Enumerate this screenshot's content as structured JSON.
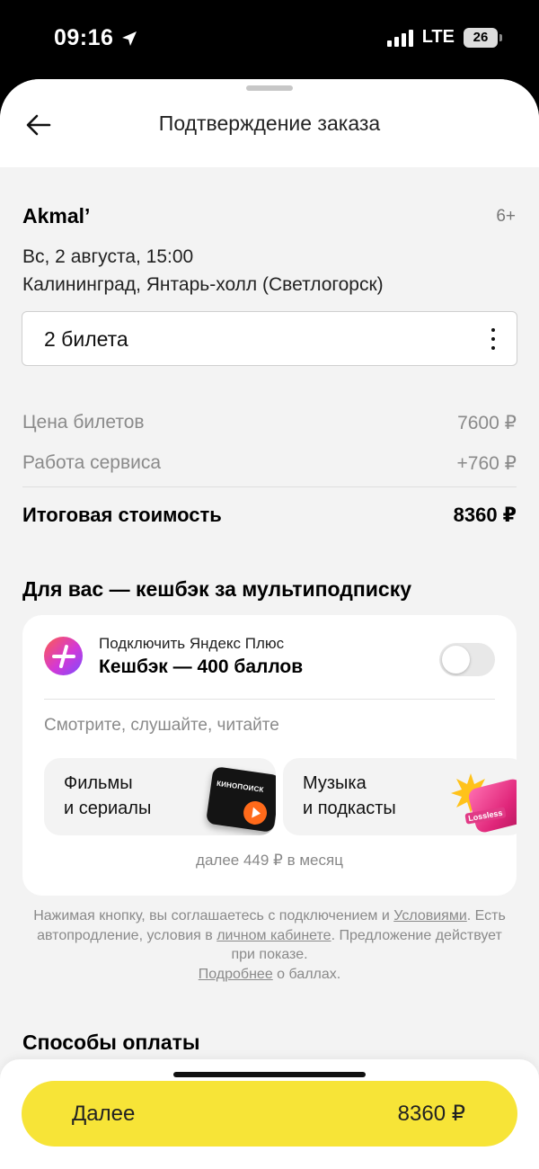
{
  "status_bar": {
    "time": "09:16",
    "network": "LTE",
    "battery": "26"
  },
  "header": {
    "title": "Подтверждение заказа"
  },
  "event": {
    "title": "Akmal’",
    "age": "6+",
    "date": "Вс, 2 августа, 15:00",
    "place": "Калининград, Янтарь-холл (Светлогорск)"
  },
  "tickets": {
    "selected": "2 билета"
  },
  "prices": {
    "tickets_label": "Цена билетов",
    "tickets_value": "7600 ₽",
    "service_label": "Работа сервиса",
    "service_value": "+760 ₽",
    "total_label": "Итоговая стоимость",
    "total_value": "8360 ₽"
  },
  "plus": {
    "section_title": "Для вас — кешбэк за мультиподписку",
    "subtitle": "Подключить Яндекс Плюс",
    "cashback": "Кешбэк — 400 баллов",
    "toggle_on": false,
    "caption": "Смотрите, слушайте, читайте",
    "tiles": [
      {
        "line1": "Фильмы",
        "line2": "и сериалы",
        "icon": "kinopoisk-icon",
        "badge": "КИНОПОИСК"
      },
      {
        "line1": "Музыка",
        "line2": "и подкасты",
        "icon": "music-icon",
        "badge": "Lossless"
      }
    ],
    "note": "далее 449 ₽ в месяц"
  },
  "legal": {
    "part1": "Нажимая кнопку, вы соглашаетесь с подключением и ",
    "link_terms": "Условиями",
    "part2": ". Есть автопродление, условия в ",
    "link_cabinet": "личном кабинете",
    "part3": ". Предложение действует при показе.",
    "link_more": "Подробнее",
    "part4": " о баллах."
  },
  "payment": {
    "section_title": "Способы оплаты"
  },
  "cta": {
    "label": "Далее",
    "price": "8360 ₽",
    "color": "#f7e437"
  }
}
